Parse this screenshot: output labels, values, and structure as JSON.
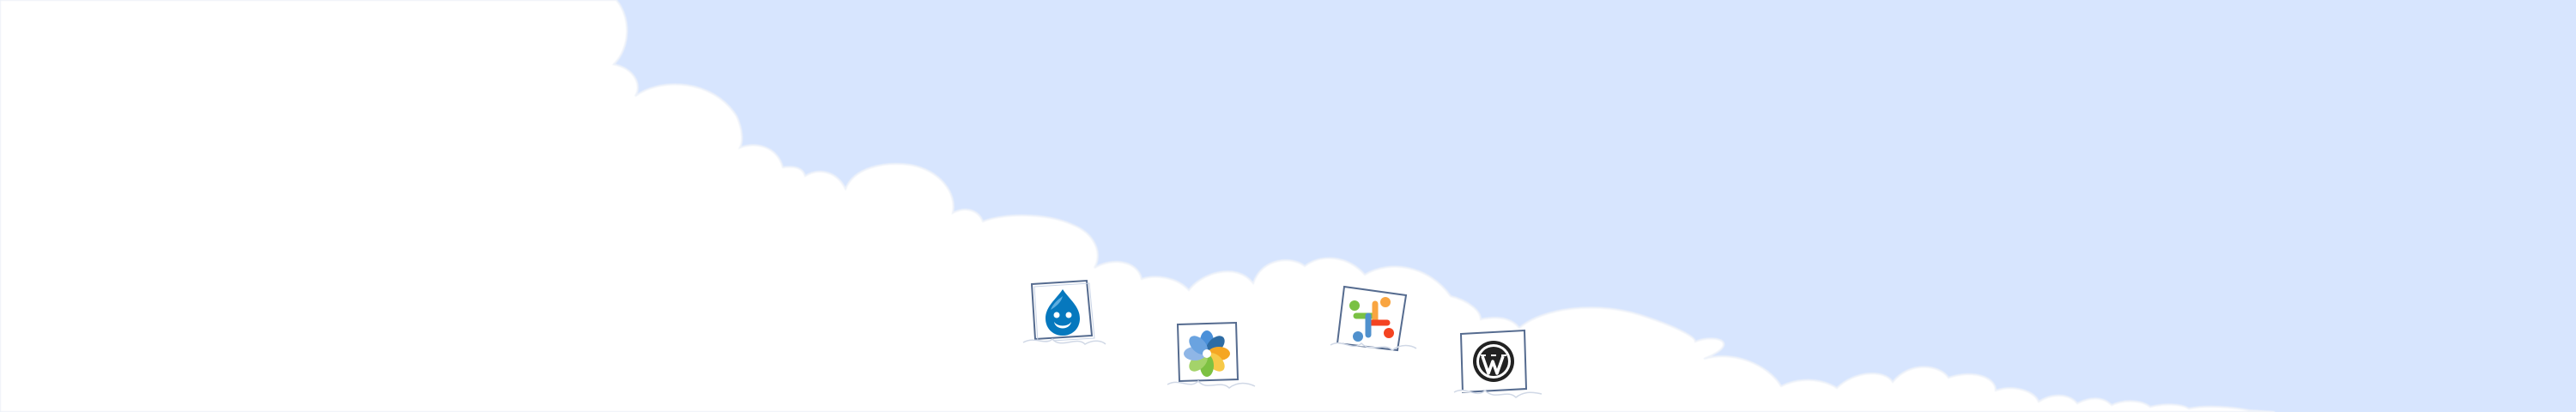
{
  "scene": {
    "sky_color": "#d7e5fe",
    "cloud_color": "#ffffff",
    "cloud_outline_color": "#e8eef8"
  },
  "logos": [
    {
      "name": "drupal",
      "icon": "drupal-drop-icon",
      "brand_color": "#0678be"
    },
    {
      "name": "alfresco",
      "icon": "alfresco-flower-icon",
      "brand_colors": [
        "#4a90d9",
        "#7dc142",
        "#f5a623",
        "#2e6ca4"
      ]
    },
    {
      "name": "joomla",
      "icon": "joomla-knot-icon",
      "brand_colors": [
        "#f44321",
        "#7ac143",
        "#5091cd",
        "#f9a541"
      ]
    },
    {
      "name": "wordpress",
      "icon": "wordpress-w-icon",
      "brand_color": "#222222"
    }
  ]
}
